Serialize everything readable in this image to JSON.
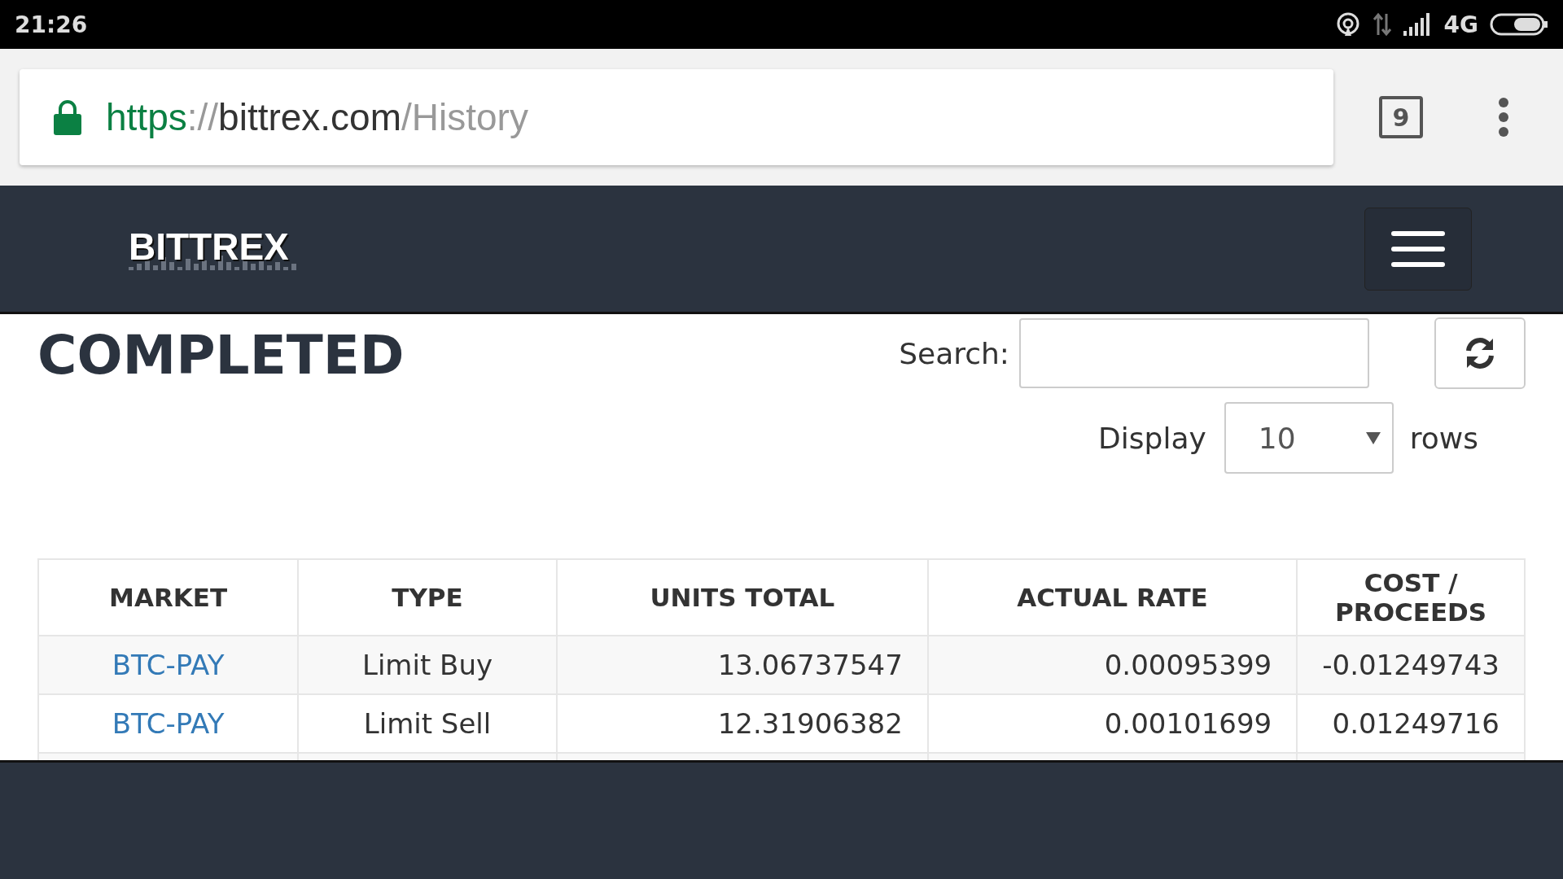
{
  "status_bar": {
    "time": "21:26",
    "network": "4G"
  },
  "browser": {
    "url": {
      "scheme": "https",
      "separator": "://",
      "host": "bittrex.com",
      "path": "/History"
    },
    "tab_count": "9"
  },
  "navbar": {
    "logo": "BITTREX"
  },
  "page": {
    "title": "COMPLETED",
    "search": {
      "label": "Search:"
    },
    "display": {
      "label": "Display",
      "value": "10",
      "suffix": "rows"
    }
  },
  "table": {
    "columns": [
      "MARKET",
      "TYPE",
      "UNITS TOTAL",
      "ACTUAL RATE",
      "COST / PROCEEDS"
    ],
    "rows": [
      {
        "market": "BTC-PAY",
        "type": "Limit Buy",
        "units_total": "13.06737547",
        "actual_rate": "0.00095399",
        "cost_proceeds": "-0.01249743"
      },
      {
        "market": "BTC-PAY",
        "type": "Limit Sell",
        "units_total": "12.31906382",
        "actual_rate": "0.00101699",
        "cost_proceeds": "0.01249716"
      }
    ]
  }
}
